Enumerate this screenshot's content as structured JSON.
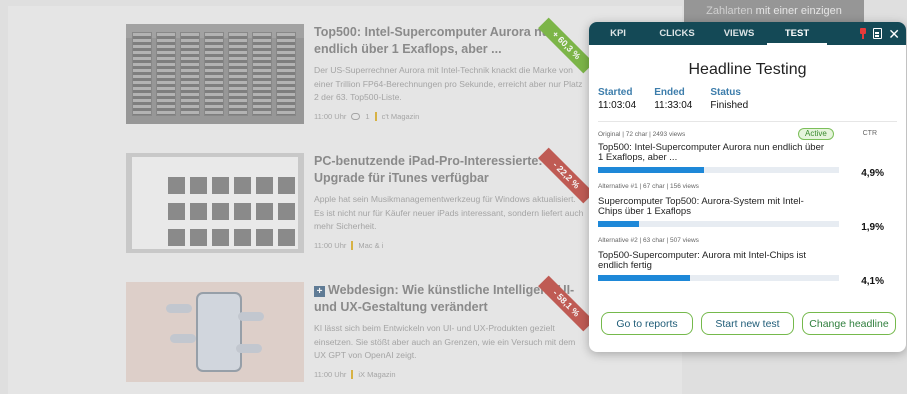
{
  "banner": {
    "text_plain": "Zahlarten",
    "text_bold": "mit einer einzigen"
  },
  "articles": [
    {
      "title": "Top500: Intel-Supercomputer Aurora nun endlich über 1 Exaflops, aber ...",
      "teaser": "Der US-Superrechner Aurora mit Intel-Technik knackt die Marke von einer Trillion FP64-Berechnungen pro Sekunde, erreicht aber nur Platz 2 der 63. Top500-Liste.",
      "time": "11:00 Uhr",
      "comments": "1",
      "source": "c't Magazin",
      "ribbon": "+ 60,3 %",
      "ribbon_color": "#7dbb45"
    },
    {
      "title": "PC-benutzende iPad-Pro-Interessierte: Upgrade für iTunes verfügbar",
      "teaser": "Apple hat sein Musikmanagementwerkzeug für Windows aktualisiert. Es ist nicht nur für Käufer neuer iPads interessant, sondern liefert auch mehr Sicherheit.",
      "time": "11:00 Uhr",
      "source": "Mac & i",
      "ribbon": "- 22,2 %",
      "ribbon_color": "#c65a52"
    },
    {
      "title": "Webdesign: Wie künstliche Intelligenz UI- und UX-Gestaltung verändert",
      "teaser": "KI lässt sich beim Entwickeln von UI- und UX-Produkten gezielt einsetzen. Sie stößt aber auch an Grenzen, wie ein Versuch mit dem UX GPT von OpenAI zeigt.",
      "time": "11:00 Uhr",
      "source": "iX Magazin",
      "ribbon": "- 58,1 %",
      "ribbon_color": "#c65a52"
    }
  ],
  "widget": {
    "tabs": [
      "KPI",
      "CLICKS",
      "VIEWS",
      "TEST"
    ],
    "active_tab": "TEST",
    "title": "Headline Testing",
    "started_label": "Started",
    "started_value": "11:03:04",
    "ended_label": "Ended",
    "ended_value": "11:33:04",
    "status_label": "Status",
    "status_value": "Finished",
    "ctr_header": "CTR",
    "variants": [
      {
        "meta": "Original | 72 char | 2493 views",
        "badge": "Active",
        "headline": "Top500: Intel-Supercomputer Aurora nun endlich über 1 Exaflops, aber ...",
        "ctr": "4,9%",
        "bar_fraction": 0.44
      },
      {
        "meta": "Alternative #1 | 67 char | 156 views",
        "headline": "Supercomputer Top500: Aurora-System mit Intel-Chips über 1 Exaflops",
        "ctr": "1,9%",
        "bar_fraction": 0.17
      },
      {
        "meta": "Alternative #2 | 63 char | 507 views",
        "headline": "Top500-Supercomputer: Aurora mit Intel-Chips ist endlich fertig",
        "ctr": "4,1%",
        "bar_fraction": 0.38
      }
    ],
    "buttons": {
      "reports": "Go to reports",
      "new_test": "Start new test",
      "change": "Change headline"
    },
    "colors": {
      "header": "#144956",
      "accent_blue": "#1e88d8",
      "button_border": "#75b94c"
    }
  }
}
